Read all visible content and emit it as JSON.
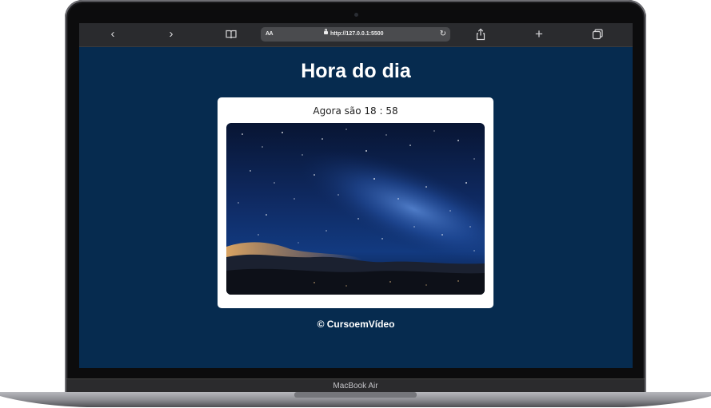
{
  "browser": {
    "text_size_label": "AA",
    "url": "http://127.0.0.1:5500",
    "icons": [
      "back-icon",
      "forward-icon",
      "book-icon",
      "lock-icon",
      "reload-icon",
      "share-icon",
      "plus-icon",
      "tabs-icon"
    ]
  },
  "page": {
    "title": "Hora do dia",
    "time_message": "Agora são 18 : 58",
    "footer": "© CursoemVídeo",
    "background_color": "#062b4f"
  },
  "device": {
    "model_label": "MacBook Air"
  }
}
